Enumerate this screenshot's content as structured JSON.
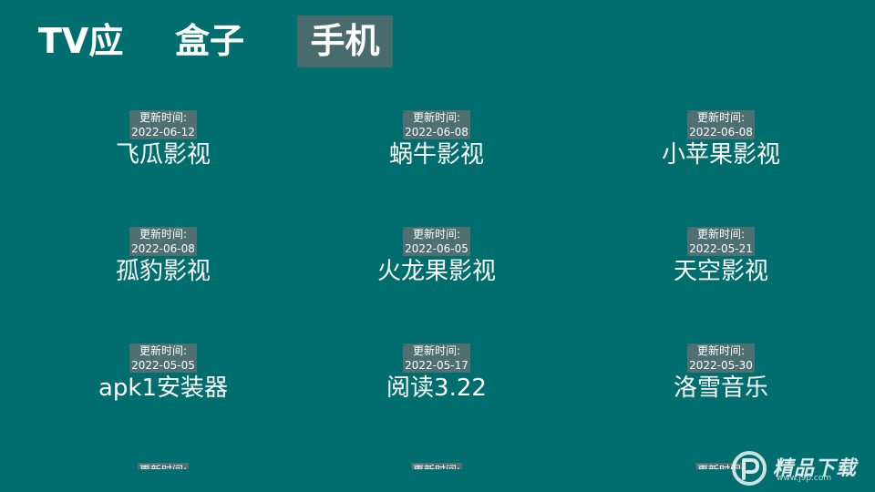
{
  "tabs": [
    {
      "label": "TV应"
    },
    {
      "label": "盒子"
    },
    {
      "label": "手机",
      "selected": true
    }
  ],
  "update_label": "更新时间:",
  "apps": [
    {
      "name": "飞瓜影视",
      "date": "2022-06-12"
    },
    {
      "name": "蜗牛影视",
      "date": "2022-06-08"
    },
    {
      "name": "小苹果影视",
      "date": "2022-06-08"
    },
    {
      "name": "孤豹影视",
      "date": "2022-06-08"
    },
    {
      "name": "火龙果影视",
      "date": "2022-06-05"
    },
    {
      "name": "天空影视",
      "date": "2022-05-21"
    },
    {
      "name": "apk1安装器",
      "date": "2022-05-05"
    },
    {
      "name": "阅读3.22",
      "date": "2022-05-17"
    },
    {
      "name": "洛雪音乐",
      "date": "2022-05-30"
    }
  ],
  "watermark": {
    "text": "精品下载",
    "url": "www.j9p.com"
  },
  "colors": {
    "background": "#006e6e",
    "selected_tab": "#4a6b6e",
    "badge": "#4e7073",
    "text": "#ffffff"
  }
}
